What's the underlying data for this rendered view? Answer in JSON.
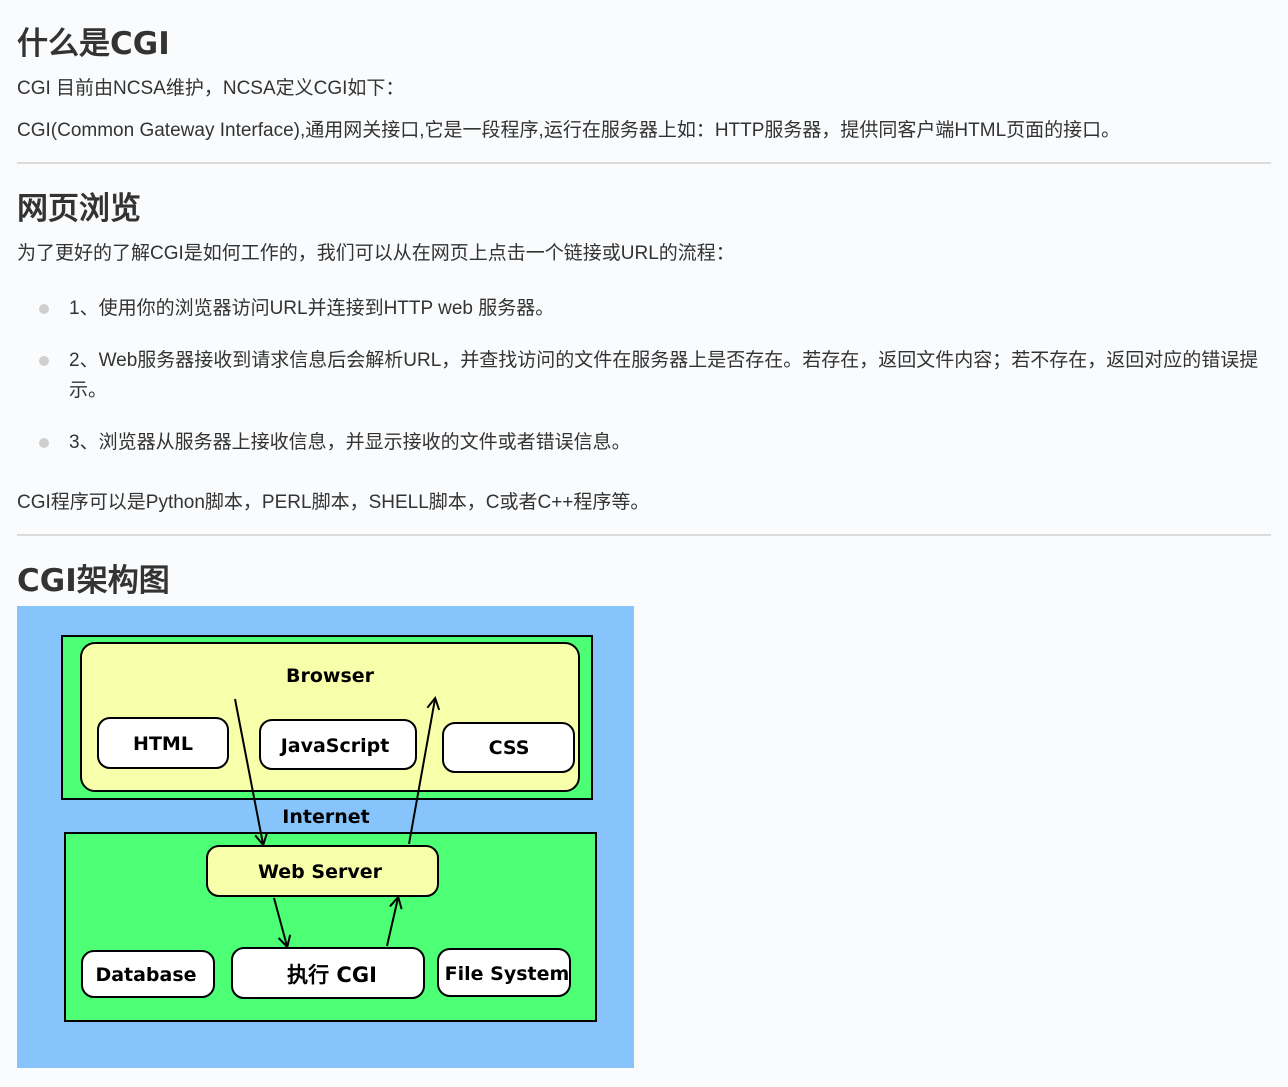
{
  "section1": {
    "title": "什么是CGI",
    "p1": "CGI 目前由NCSA维护，NCSA定义CGI如下：",
    "p2": "CGI(Common Gateway Interface),通用网关接口,它是一段程序,运行在服务器上如：HTTP服务器，提供同客户端HTML页面的接口。"
  },
  "section2": {
    "title": "网页浏览",
    "intro": "为了更好的了解CGI是如何工作的，我们可以从在网页上点击一个链接或URL的流程：",
    "steps": [
      "1、使用你的浏览器访问URL并连接到HTTP web 服务器。",
      "2、Web服务器接收到请求信息后会解析URL，并查找访问的文件在服务器上是否存在。若存在，返回文件内容；若不存在，返回对应的错误提示。",
      "3、浏览器从服务器上接收信息，并显示接收的文件或者错误信息。"
    ],
    "outro": "CGI程序可以是Python脚本，PERL脚本，SHELL脚本，C或者C++程序等。"
  },
  "section3": {
    "title": "CGI架构图"
  },
  "diagram": {
    "browser_label": "Browser",
    "html_label": "HTML",
    "javascript_label": "JavaScript",
    "css_label": "CSS",
    "internet_label": "Internet",
    "webserver_label": "Web Server",
    "database_label": "Database",
    "cgi_label": "执行 CGI",
    "filesystem_label": "File System",
    "colors": {
      "background": "#87c4fb",
      "green": "#4cff74",
      "yellow": "#f7ffaa",
      "box": "#ffffff"
    }
  }
}
